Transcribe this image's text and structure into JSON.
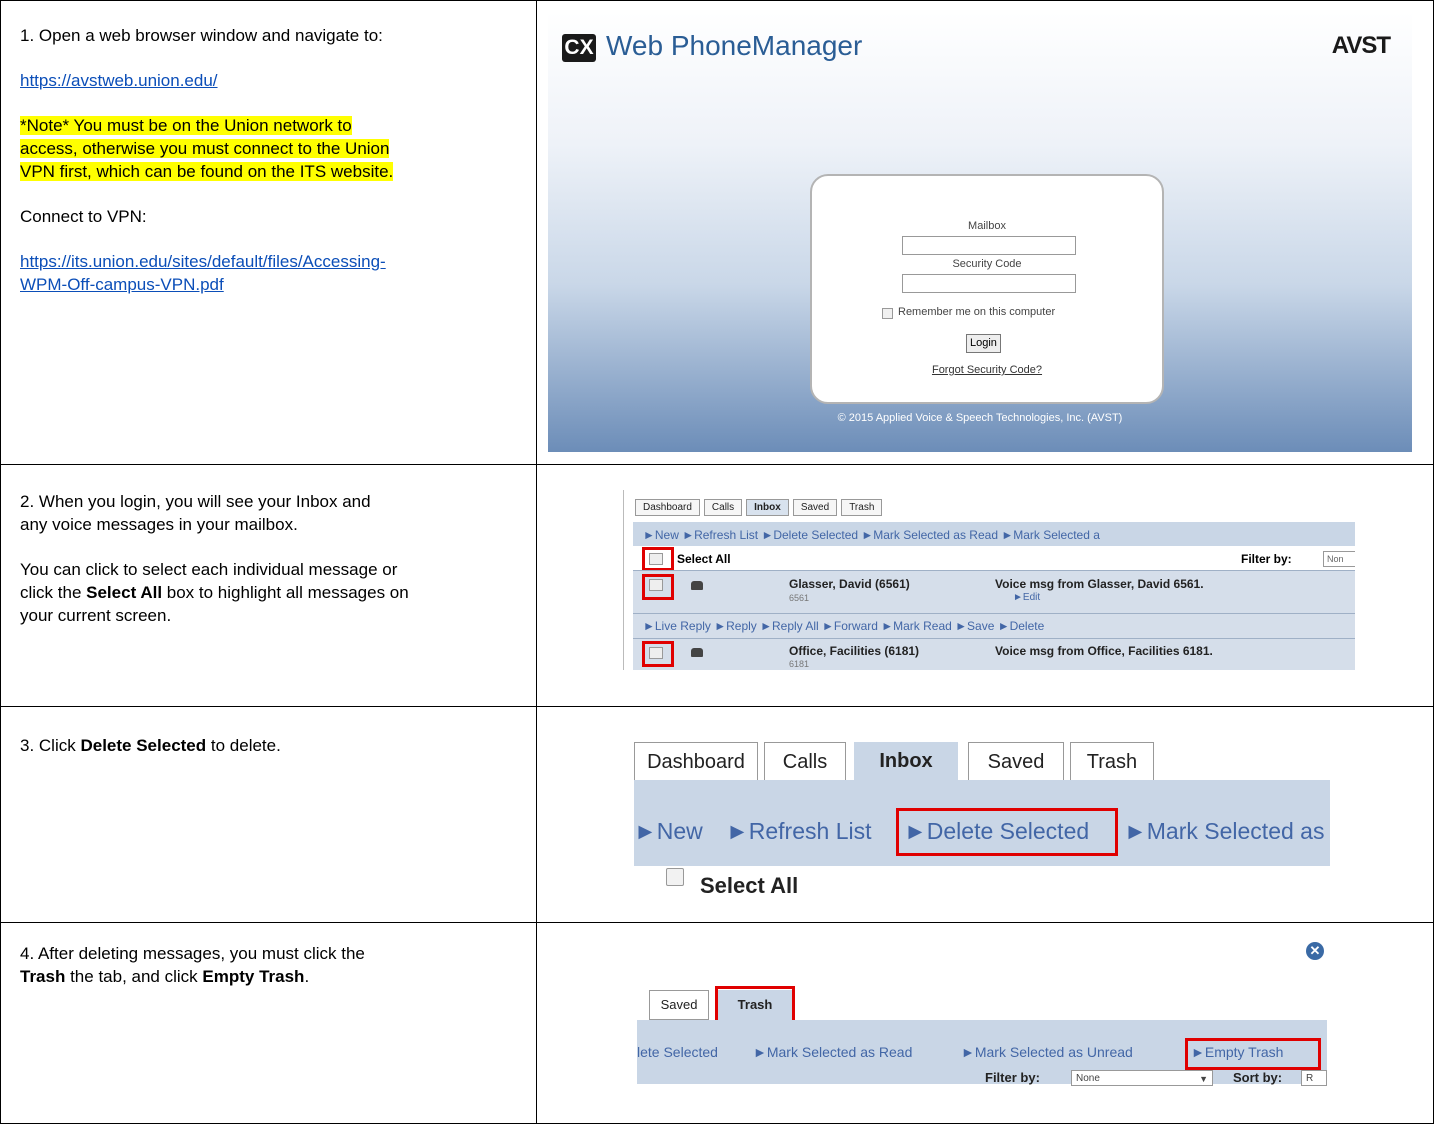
{
  "step1": {
    "instruction": "1.  Open a web browser window and navigate to:",
    "link": "https://avstweb.union.edu/",
    "note": "*Note* You must be on the Union network to access, otherwise you must connect to the Union VPN first, which can be found on the ITS website.",
    "note_lines": [
      "*Note* You must be on the Union network to",
      "access, otherwise you must connect to the Union",
      "VPN first, which can be found on the ITS website."
    ],
    "vpn_label": "Connect to VPN:",
    "vpn_link": "https://its.union.edu/sites/default/files/Accessing-WPM-Off-campus-VPN.pdf",
    "vpn_link_lines": [
      "https://its.union.edu/sites/default/files/Accessing-",
      "WPM-Off-campus-VPN.pdf"
    ],
    "screenshot": {
      "logo": "CX",
      "app_title": "Web PhoneManager",
      "brand": "AVST",
      "mailbox_label": "Mailbox",
      "security_label": "Security Code",
      "remember_label": "Remember me on this computer",
      "login_button": "Login",
      "forgot_link": "Forgot Security Code?",
      "copyright": "© 2015 Applied Voice & Speech Technologies, Inc. (AVST)"
    }
  },
  "step2": {
    "line1": "2.  When you login, you will see your Inbox and",
    "line2": "any voice messages in your mailbox.",
    "p2_line1": "You can click to select each individual message or",
    "p2_line2_pre": "click the ",
    "p2_line2_bold": "Select All",
    "p2_line2_post": " box to highlight all messages on",
    "p2_line3": "your current screen.",
    "screenshot": {
      "tabs": [
        "Dashboard",
        "Calls",
        "Inbox",
        "Saved",
        "Trash"
      ],
      "actions": "►New  ►Refresh List  ►Delete Selected  ►Mark Selected as Read  ►Mark Selected a",
      "select_all": "Select All",
      "filter_label": "Filter by:",
      "filter_value": "Non",
      "msg1_name": "Glasser, David (6561)",
      "msg1_ext": "6561",
      "msg1_subject": "Voice msg from Glasser, David 6561.",
      "msg1_edit": "►Edit",
      "msg_actions": "►Live Reply  ►Reply  ►Reply All  ►Forward  ►Mark Read  ►Save  ►Delete",
      "msg2_name": "Office, Facilities (6181)",
      "msg2_ext": "6181",
      "msg2_subject": "Voice msg from Office, Facilities 6181."
    }
  },
  "step3": {
    "pre": "3.  Click ",
    "bold": "Delete Selected",
    "post": " to delete.",
    "screenshot": {
      "tabs": [
        "Dashboard",
        "Calls",
        "Inbox",
        "Saved",
        "Trash"
      ],
      "new": "►New",
      "refresh": "►Refresh List",
      "delete_selected": "►Delete Selected",
      "mark_selected": "►Mark Selected as",
      "select_all": "Select All"
    }
  },
  "step4": {
    "line1": "4. After deleting messages, you must click the",
    "bold1": "Trash",
    "mid": " the tab, and click ",
    "bold2": "Empty Trash",
    "end": ".",
    "screenshot": {
      "close_glyph": "✕",
      "tab_saved": "Saved",
      "tab_trash": "Trash",
      "act1": "lete Selected",
      "act2": "►Mark Selected as Read",
      "act3": "►Mark Selected as Unread",
      "act4": "►Empty Trash",
      "filter_label": "Filter by:",
      "filter_value": "None",
      "sort_label": "Sort by:",
      "sort_value": "R"
    }
  }
}
